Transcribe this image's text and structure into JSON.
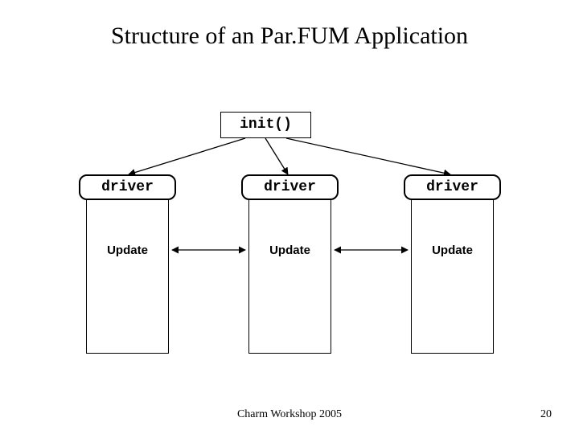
{
  "title": "Structure of an Par.FUM Application",
  "init_label": "init()",
  "drivers": [
    "driver",
    "driver",
    "driver"
  ],
  "updates": [
    "Update",
    "Update",
    "Update"
  ],
  "footer_center": "Charm Workshop 2005",
  "page_number": "20"
}
